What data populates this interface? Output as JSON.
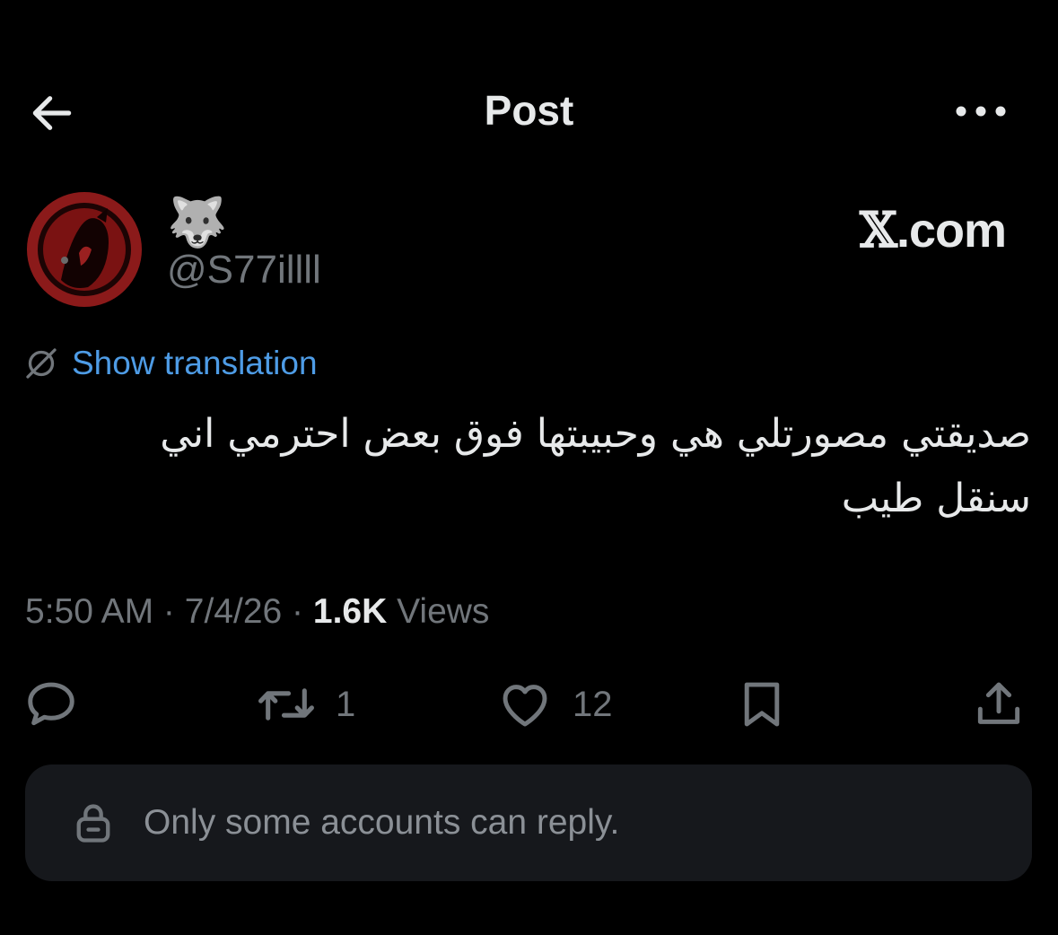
{
  "header": {
    "title": "Post"
  },
  "author": {
    "display_name": "🐺",
    "handle": "@S77illll",
    "avatar_colors": {
      "ring": "#8b1a1a",
      "fill": "#1a0505"
    }
  },
  "watermark": {
    "x": "𝕏",
    "rest": ".com"
  },
  "translation": {
    "label": "Show translation",
    "color": "#4e9ce6"
  },
  "post": {
    "line1": "صديقتي مصورتلي هي وحبيبتها فوق بعض احترمي اني",
    "line2": "سنقل طيب",
    "time": "5:50 AM",
    "sep1": " · ",
    "date": "7/4/26",
    "sep2": " · ",
    "views_count": "1.6K",
    "views_label": " Views"
  },
  "actions": {
    "reply_count": "",
    "repost_count": "1",
    "like_count": "12"
  },
  "reply_restriction": {
    "text": "Only some accounts can reply."
  }
}
